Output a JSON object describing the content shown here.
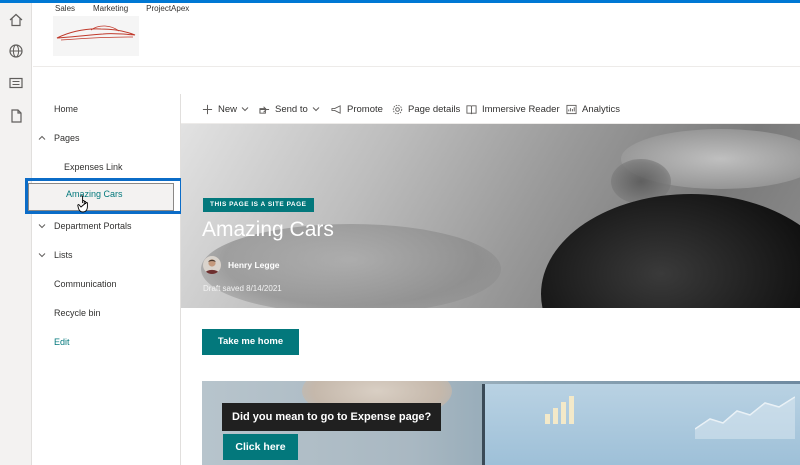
{
  "site": {
    "links": [
      "Sales",
      "Marketing",
      "ProjectApex"
    ]
  },
  "nav": {
    "home": "Home",
    "pages": "Pages",
    "expenses_link": "Expenses Link",
    "amazing_cars": "Amazing Cars",
    "department_portals": "Department Portals",
    "lists": "Lists",
    "communication": "Communication",
    "recycle_bin": "Recycle bin",
    "edit": "Edit"
  },
  "commands": {
    "new": "New",
    "send_to": "Send to",
    "promote": "Promote",
    "page_details": "Page details",
    "immersive_reader": "Immersive Reader",
    "analytics": "Analytics"
  },
  "hero": {
    "badge": "THIS PAGE IS A SITE PAGE",
    "title": "Amazing Cars",
    "author": "Henry Legge",
    "draft": "Draft saved 8/14/2021"
  },
  "buttons": {
    "take_me_home": "Take me home",
    "click_here": "Click here"
  },
  "banner": {
    "question": "Did you mean to go to Expense page?"
  },
  "colors": {
    "accent": "#03787c",
    "selection": "#0b6cc7",
    "topline": "#0078d4"
  },
  "icons": {
    "rail": [
      "home-icon",
      "globe-icon",
      "news-icon",
      "document-icon"
    ]
  }
}
